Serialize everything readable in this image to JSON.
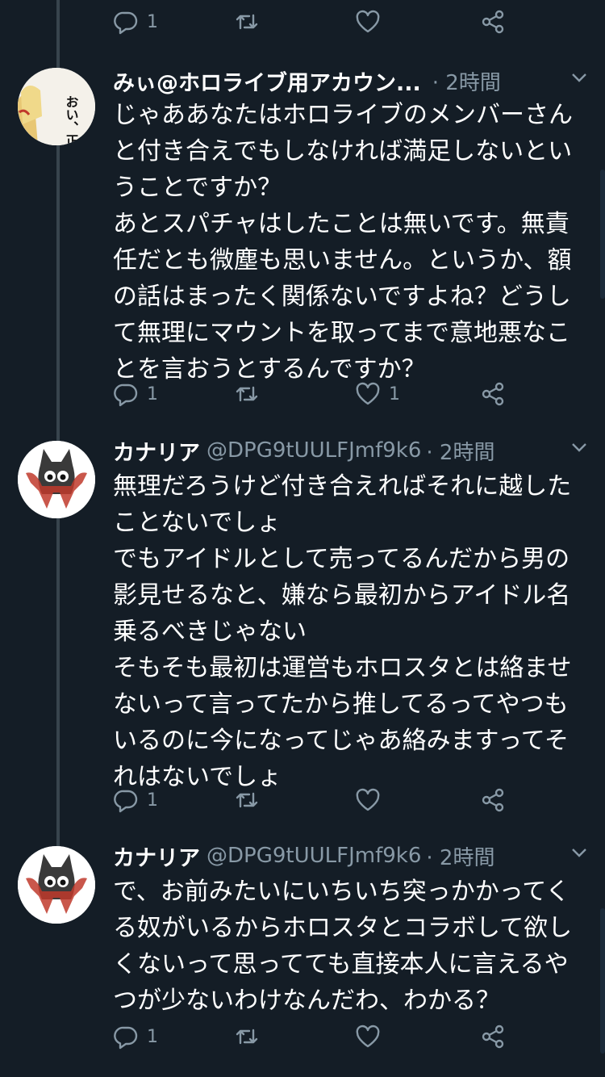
{
  "top_actions": {
    "reply_count": "1",
    "retweet_count": "",
    "like_count": ""
  },
  "tweets": [
    {
      "name": "みぃ@ホロライブ用アカウン...",
      "handle": "",
      "time": "· 2時間",
      "avatar_icon": "manga-avatar-icon",
      "avatar_text": "おい、正気か？",
      "lines": [
        "じゃああなたはホロライブのメンバーさん",
        "と付き合えでもしなければ満足しないとい",
        "うことですか？",
        "あとスパチャはしたことは無いです。無責",
        "任だとも微塵も思いません。というか、額",
        "の話はまったく関係ないですよね？どうし",
        "て無理にマウントを取ってまで意地悪なこ",
        "とを言おうとするんですか？"
      ],
      "reply_count": "1",
      "retweet_count": "",
      "like_count": "1"
    },
    {
      "name": "カナリア",
      "handle": "@DPG9tUULFJmf9k6",
      "time": "· 2時間",
      "avatar_icon": "black-cat-avatar-icon",
      "lines": [
        "無理だろうけど付き合えればそれに越した",
        "ことないでしょ",
        "でもアイドルとして売ってるんだから男の",
        "影見せるなと、嫌なら最初からアイドル名",
        "乗るべきじゃない",
        "そもそも最初は運営もホロスタとは絡ませ",
        "ないって言ってたから推してるってやつも",
        "いるのに今になってじゃあ絡みますってそ",
        "れはないでしょ"
      ],
      "reply_count": "1",
      "retweet_count": "",
      "like_count": ""
    },
    {
      "name": "カナリア",
      "handle": "@DPG9tUULFJmf9k6",
      "time": "· 2時間",
      "avatar_icon": "black-cat-avatar-icon",
      "lines": [
        "で、お前みたいにいちいち突っかかってく",
        "る奴がいるからホロスタとコラボして欲し",
        "くないって思ってても直接本人に言えるや",
        "つが少ないわけなんだわ、わかる？"
      ],
      "reply_count": "1",
      "retweet_count": "",
      "like_count": ""
    }
  ],
  "colors": {
    "background": "#141d26",
    "muted": "#8899a6",
    "thread_line": "#38444d"
  }
}
